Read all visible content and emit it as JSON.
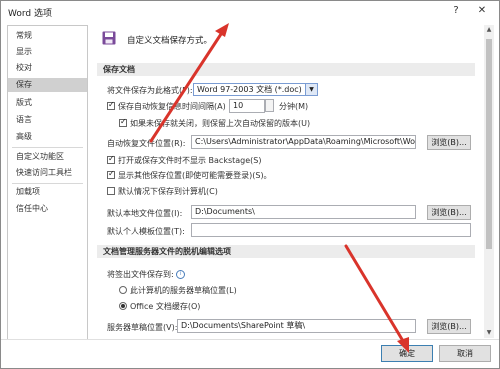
{
  "window": {
    "title": "Word 选项",
    "help": "?",
    "close": "✕"
  },
  "sidebar": {
    "items": [
      {
        "label": "常规"
      },
      {
        "label": "显示"
      },
      {
        "label": "校对"
      },
      {
        "label": "保存"
      },
      {
        "label": "版式"
      },
      {
        "label": "语言"
      },
      {
        "label": "高级"
      },
      {
        "label": "自定义功能区"
      },
      {
        "label": "快速访问工具栏"
      },
      {
        "label": "加载项"
      },
      {
        "label": "信任中心"
      }
    ],
    "selected": "保存"
  },
  "header": {
    "title": "自定义文档保存方式。",
    "icon": "save-disk-icon"
  },
  "save_docs": {
    "section": "保存文档",
    "format_label": "将文件保存为此格式(F):",
    "format_value": "Word 97-2003 文档 (*.doc)",
    "autorecover_label": "保存自动恢复信息时间间隔(A)",
    "autorecover_checked": true,
    "autorecover_minutes": "10",
    "minutes_label": "分钟(M)",
    "keep_last_label": "如果未保存就关闭，则保留上次自动保留的版本(U)",
    "keep_last_checked": true,
    "autorecover_path_label": "自动恢复文件位置(R):",
    "autorecover_path": "C:\\Users\\Administrator\\AppData\\Roaming\\Microsoft\\Word\\",
    "browse1": "浏览(B)...",
    "backstage_label": "打开或保存文件时不显示 Backstage(S)",
    "backstage_checked": true,
    "other_locations_label": "显示其他保存位置(即使可能需要登录)(S)。",
    "other_locations_checked": true,
    "default_computer_label": "默认情况下保存到计算机(C)",
    "default_computer_checked": false,
    "local_path_label": "默认本地文件位置(I):",
    "local_path": "D:\\Documents\\",
    "browse2": "浏览(B)...",
    "template_label": "默认个人模板位置(T):",
    "template_path": ""
  },
  "offline": {
    "section": "文档管理服务器文件的脱机编辑选项",
    "checkout_label": "将签出文件保存到:",
    "option1": "此计算机的服务器草稿位置(L)",
    "option2": "Office 文档缓存(O)",
    "selected_option": "Office 文档缓存(O)",
    "drafts_label": "服务器草稿位置(V):",
    "drafts_path": "D:\\Documents\\SharePoint 草稿\\",
    "browse3": "浏览(B)..."
  },
  "footer": {
    "ok": "确定",
    "cancel": "取消"
  },
  "colors": {
    "accent": "#3c7fb1",
    "annotation": "#d9342b",
    "selected_nav": "#d0d0d0"
  }
}
